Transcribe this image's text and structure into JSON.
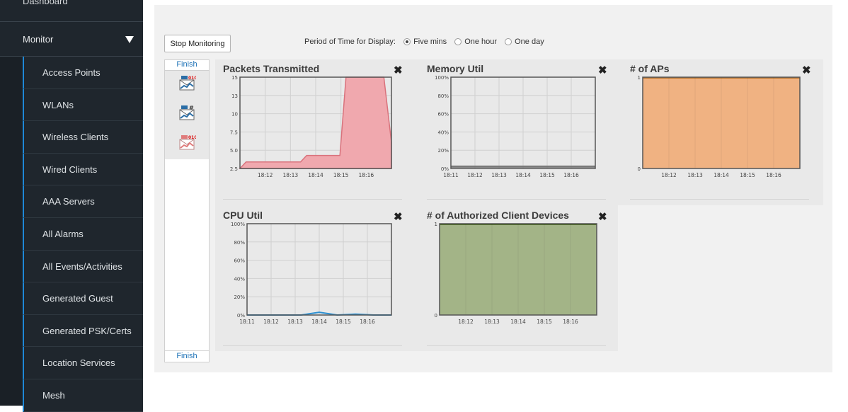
{
  "sidebar": {
    "dashboard": "Dashboard",
    "monitor": "Monitor",
    "items": [
      {
        "label": "Access Points"
      },
      {
        "label": "WLANs"
      },
      {
        "label": "Wireless Clients"
      },
      {
        "label": "Wired Clients"
      },
      {
        "label": "AAA Servers"
      },
      {
        "label": "All Alarms"
      },
      {
        "label": "All Events/Activities"
      },
      {
        "label": "Generated Guest"
      },
      {
        "label": "Generated PSK/Certs"
      },
      {
        "label": "Location Services"
      },
      {
        "label": "Mesh"
      }
    ]
  },
  "toolbar": {
    "stop_label": "Stop Monitoring",
    "period_label": "Period of Time for Display:",
    "options": [
      "Five mins",
      "One hour",
      "One day"
    ],
    "selected": "Five mins"
  },
  "finish": {
    "top": "Finish",
    "bottom": "Finish"
  },
  "panels": {
    "packets": "Packets Transmitted",
    "memory": "Memory Util",
    "aps": "# of APs",
    "cpu": "CPU Util",
    "clients": "# of Authorized Client Devices",
    "close": "✖"
  },
  "colors": {
    "packets": "#f0a8ae",
    "aps": "#f0b282",
    "clients": "#a3b487",
    "cpu": "#2b8fd1",
    "memory": "#7a7a7a"
  },
  "chart_data": [
    {
      "type": "area",
      "title": "Packets Transmitted",
      "x": [
        "18:11:45",
        "18:11:55",
        "18:12",
        "18:13",
        "18:13:50",
        "18:14",
        "18:15",
        "18:15:10",
        "18:16",
        "18:16:10"
      ],
      "xticks": [
        "18:12",
        "18:13",
        "18:14",
        "18:15",
        "18:16"
      ],
      "yticks": [
        "2.5",
        "5.0",
        "7.5",
        "10",
        "13",
        "15"
      ],
      "values": [
        2,
        3,
        3,
        3,
        4,
        4,
        4,
        16,
        16,
        6
      ],
      "ylim": [
        2,
        16
      ]
    },
    {
      "type": "line",
      "title": "Memory Util",
      "xticks": [
        "18:11",
        "18:12",
        "18:13",
        "18:14",
        "18:15",
        "18:16"
      ],
      "yticks": [
        "0%",
        "20%",
        "40%",
        "60%",
        "80%",
        "100%"
      ],
      "values": [
        2,
        2,
        2,
        2,
        2,
        2
      ],
      "ylim": [
        0,
        100
      ]
    },
    {
      "type": "area",
      "title": "# of APs",
      "xticks": [
        "18:12",
        "18:13",
        "18:14",
        "18:15",
        "18:16"
      ],
      "yticks": [
        "0",
        "1"
      ],
      "values": [
        1,
        1,
        1,
        1,
        1
      ],
      "ylim": [
        0,
        1
      ]
    },
    {
      "type": "line",
      "title": "CPU Util",
      "xticks": [
        "18:11",
        "18:12",
        "18:13",
        "18:14",
        "18:15",
        "18:16"
      ],
      "yticks": [
        "0%",
        "20%",
        "40%",
        "60%",
        "80%",
        "100%"
      ],
      "values": [
        0,
        0,
        0,
        0,
        3,
        0,
        1,
        0,
        0
      ],
      "ylim": [
        0,
        100
      ]
    },
    {
      "type": "area",
      "title": "# of Authorized Client Devices",
      "xticks": [
        "18:12",
        "18:13",
        "18:14",
        "18:15",
        "18:16"
      ],
      "yticks": [
        "0",
        "1"
      ],
      "values": [
        1,
        1,
        1,
        1,
        1
      ],
      "ylim": [
        0,
        1
      ]
    }
  ]
}
